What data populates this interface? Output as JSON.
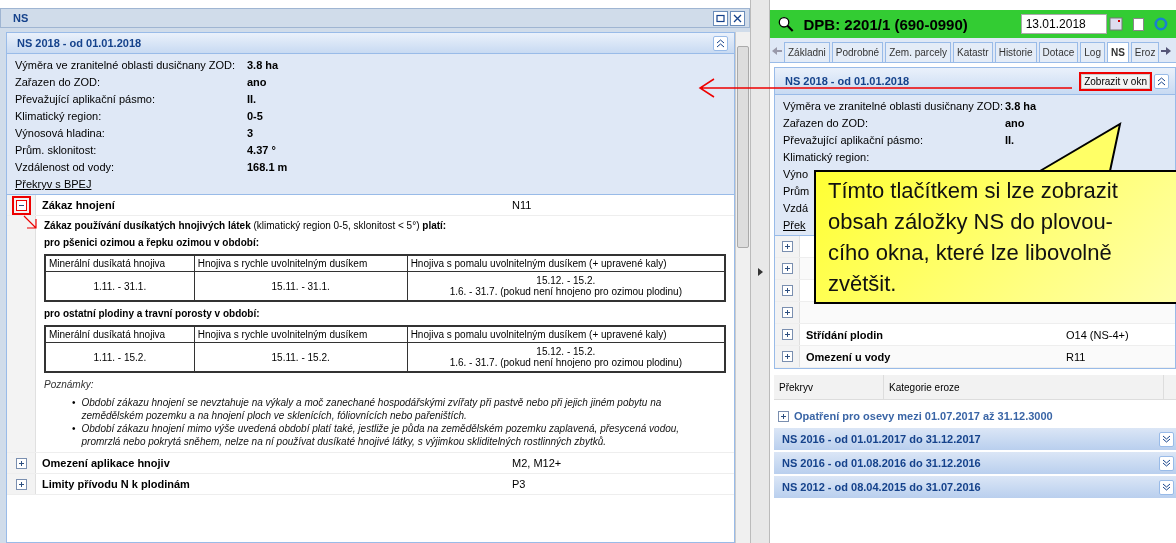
{
  "left_window": {
    "title": "NS",
    "panel": {
      "title": "NS 2018 - od 01.01.2018",
      "expanded": true,
      "facts": [
        {
          "label": "Výměra ve zranitelné oblasti dusičnany ZOD:",
          "value": "3.8 ha"
        },
        {
          "label": "Zařazen do ZOD:",
          "value": "ano"
        },
        {
          "label": "Převažující aplikační pásmo:",
          "value": "II."
        },
        {
          "label": "Klimatický region:",
          "value": "0-5"
        },
        {
          "label": "Výnosová hladina:",
          "value": "3"
        },
        {
          "label": "Prům. sklonitost:",
          "value": "4.37 °"
        },
        {
          "label": "Vzdálenost od vody:",
          "value": "168.1 m"
        }
      ],
      "link": "Překryv s BPEJ",
      "rules": [
        {
          "name": "Zákaz hnojení",
          "code": "N11",
          "expanded": true,
          "highlighted": true,
          "detail": {
            "heading": "**Zákaz používání dusíkatých hnojivých látek** (klimatický region 0-5, sklonitost < 5°) **platí:**",
            "periods": [
              {
                "title": "pro pšenici ozimou a řepku ozimou v období:",
                "columns": [
                  "Minerální dusíkatá hnojiva",
                  "Hnojiva s rychle uvolnitelným dusíkem",
                  "Hnojiva s pomalu uvolnitelným dusíkem (+ upravené kaly)"
                ],
                "cells": [
                  [
                    "1.11. - 31.1."
                  ],
                  [
                    "15.11. - 31.1."
                  ],
                  [
                    "15.12. - 15.2.",
                    "1.6. - 31.7. (pokud není hnojeno pro ozimou plodinu)"
                  ]
                ]
              },
              {
                "title": "pro ostatní plodiny a travní porosty v období:",
                "columns": [
                  "Minerální dusíkatá hnojiva",
                  "Hnojiva s rychle uvolnitelným dusíkem",
                  "Hnojiva s pomalu uvolnitelným dusíkem (+ upravené kaly)"
                ],
                "cells": [
                  [
                    "1.11. - 15.2."
                  ],
                  [
                    "15.11. - 15.2."
                  ],
                  [
                    "15.12. - 15.2.",
                    "1.6. - 31.7. (pokud není hnojeno pro ozimou plodinu)"
                  ]
                ]
              }
            ],
            "notes_title": "Poznámky:",
            "note_bullet": "•",
            "notes": [
              "Období zákazu hnojení se nevztahuje na výkaly a moč zanechané hospodářskými zvířaty při pastvě nebo při jejich jiném pobytu na zemědělském pozemku a na hnojení ploch ve sklenících, fóliovnících nebo pařeništích.",
              "Období zákazu hnojení mimo výše uvedená období platí také, jestliže je půda na zemědělském pozemku zaplavená, přesycená vodou, promrzlá nebo pokrytá sněhem, nelze na ní používat dusíkaté hnojivé látky, s výjimkou skliditelných rostlinných zbytků."
            ]
          }
        },
        {
          "name": "Omezení aplikace hnojiv",
          "code": "M2, M12+",
          "expanded": false,
          "highlighted": false
        },
        {
          "name": "Limity přívodu N k plodinám",
          "code": "P3",
          "expanded": false,
          "highlighted": false
        }
      ]
    }
  },
  "detail_pane": {
    "title": "DPB: 2201/1 (690-0990)",
    "date": "13.01.2018",
    "checked": false,
    "tabs": [
      {
        "label": "Základni",
        "selected": false
      },
      {
        "label": "Podrobné",
        "selected": false
      },
      {
        "label": "Zem. parcely",
        "selected": false
      },
      {
        "label": "Katastr",
        "selected": false
      },
      {
        "label": "Historie",
        "selected": false
      },
      {
        "label": "Dotace",
        "selected": false
      },
      {
        "label": "Log",
        "selected": false
      },
      {
        "label": "NS",
        "selected": true
      },
      {
        "label": "Eroz",
        "selected": false
      }
    ],
    "panel": {
      "title": "NS 2018 - od 01.01.2018",
      "button": "Zobrazit v okn",
      "button_highlighted": true,
      "expanded": true,
      "facts": [
        {
          "label": "Výměra ve zranitelné oblasti dusičnany ZOD:",
          "value": "3.8 ha"
        },
        {
          "label": "Zařazen do ZOD:",
          "value": "ano"
        },
        {
          "label": "Převažující aplikační pásmo:",
          "value": "II."
        },
        {
          "label": "Klimatický region:"
        },
        {
          "label": "Výno"
        },
        {
          "label": "Prům"
        },
        {
          "label": "Vzdá"
        }
      ],
      "link": "Přek",
      "rules": [
        {
          "expanded": false
        },
        {
          "expanded": false
        },
        {
          "expanded": false
        },
        {
          "expanded": false
        },
        {
          "name": "Střídání plodin",
          "code": "O14 (NS-4+)",
          "expanded": false
        },
        {
          "name": "Omezení u vody",
          "code": "R11",
          "expanded": false
        }
      ]
    },
    "subtabs": [
      "Překryv",
      "Kategorie eroze"
    ],
    "measure": {
      "label": "Opatření pro osevy mezi 01.07.2017 až 31.12.3000",
      "expanded": false
    },
    "older": [
      {
        "title": "NS 2016 - od 01.01.2017 do 31.12.2017",
        "expanded": false
      },
      {
        "title": "NS 2016 - od 01.08.2016 do 31.12.2016",
        "expanded": false
      },
      {
        "title": "NS 2012 - od 08.04.2015 do 31.07.2016",
        "expanded": false
      }
    ]
  },
  "callout": {
    "lines": [
      "Tímto tlačítkem si lze zobrazit",
      "obsah záložky NS do plovou-",
      "cího okna, které lze libovolně",
      "zvětšit."
    ]
  }
}
